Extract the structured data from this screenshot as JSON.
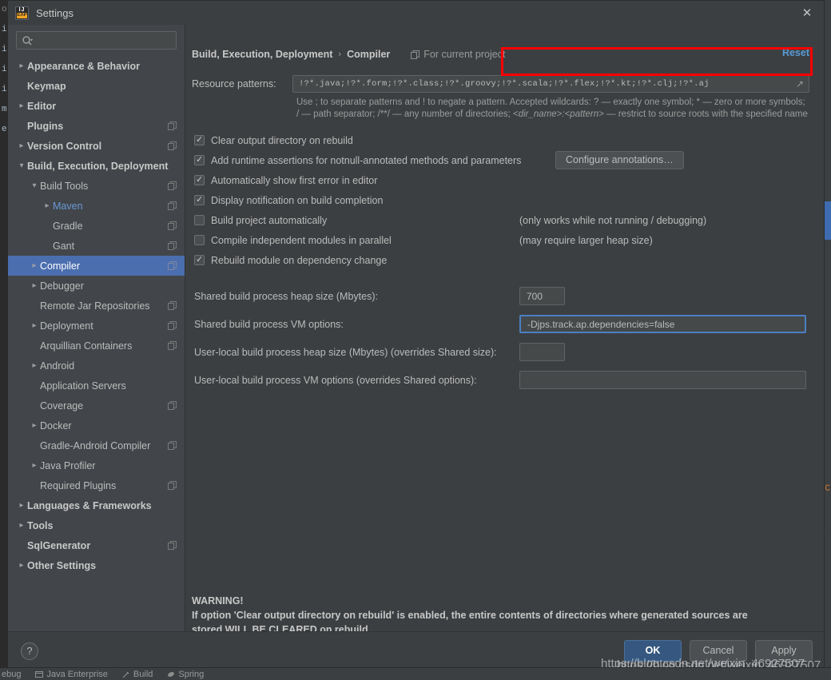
{
  "window": {
    "title": "Settings",
    "app_icon": "intellij-idea-eap-icon",
    "icon_top_text": "IJ",
    "icon_bottom_text": "EAP",
    "close_label": "✕"
  },
  "sidebar": {
    "search": {
      "placeholder": "",
      "value": "",
      "icon": "search-icon"
    },
    "items": [
      {
        "label": "Appearance & Behavior",
        "indent": 0,
        "arrow": "closed",
        "bold": true,
        "project": false,
        "selected": false,
        "blue": false
      },
      {
        "label": "Keymap",
        "indent": 0,
        "arrow": "none",
        "bold": true,
        "project": false,
        "selected": false,
        "blue": false
      },
      {
        "label": "Editor",
        "indent": 0,
        "arrow": "closed",
        "bold": true,
        "project": false,
        "selected": false,
        "blue": false
      },
      {
        "label": "Plugins",
        "indent": 0,
        "arrow": "none",
        "bold": true,
        "project": true,
        "selected": false,
        "blue": false
      },
      {
        "label": "Version Control",
        "indent": 0,
        "arrow": "closed",
        "bold": true,
        "project": true,
        "selected": false,
        "blue": false
      },
      {
        "label": "Build, Execution, Deployment",
        "indent": 0,
        "arrow": "open",
        "bold": true,
        "project": false,
        "selected": false,
        "blue": false
      },
      {
        "label": "Build Tools",
        "indent": 1,
        "arrow": "open",
        "bold": false,
        "project": true,
        "selected": false,
        "blue": false
      },
      {
        "label": "Maven",
        "indent": 2,
        "arrow": "closed",
        "bold": false,
        "project": true,
        "selected": false,
        "blue": true
      },
      {
        "label": "Gradle",
        "indent": 2,
        "arrow": "none",
        "bold": false,
        "project": true,
        "selected": false,
        "blue": false
      },
      {
        "label": "Gant",
        "indent": 2,
        "arrow": "none",
        "bold": false,
        "project": true,
        "selected": false,
        "blue": false
      },
      {
        "label": "Compiler",
        "indent": 1,
        "arrow": "closed",
        "bold": false,
        "project": true,
        "selected": true,
        "blue": false
      },
      {
        "label": "Debugger",
        "indent": 1,
        "arrow": "closed",
        "bold": false,
        "project": false,
        "selected": false,
        "blue": false
      },
      {
        "label": "Remote Jar Repositories",
        "indent": 1,
        "arrow": "none",
        "bold": false,
        "project": true,
        "selected": false,
        "blue": false
      },
      {
        "label": "Deployment",
        "indent": 1,
        "arrow": "closed",
        "bold": false,
        "project": true,
        "selected": false,
        "blue": false
      },
      {
        "label": "Arquillian Containers",
        "indent": 1,
        "arrow": "none",
        "bold": false,
        "project": true,
        "selected": false,
        "blue": false
      },
      {
        "label": "Android",
        "indent": 1,
        "arrow": "closed",
        "bold": false,
        "project": false,
        "selected": false,
        "blue": false
      },
      {
        "label": "Application Servers",
        "indent": 1,
        "arrow": "none",
        "bold": false,
        "project": false,
        "selected": false,
        "blue": false
      },
      {
        "label": "Coverage",
        "indent": 1,
        "arrow": "none",
        "bold": false,
        "project": true,
        "selected": false,
        "blue": false
      },
      {
        "label": "Docker",
        "indent": 1,
        "arrow": "closed",
        "bold": false,
        "project": false,
        "selected": false,
        "blue": false
      },
      {
        "label": "Gradle-Android Compiler",
        "indent": 1,
        "arrow": "none",
        "bold": false,
        "project": true,
        "selected": false,
        "blue": false
      },
      {
        "label": "Java Profiler",
        "indent": 1,
        "arrow": "closed",
        "bold": false,
        "project": false,
        "selected": false,
        "blue": false
      },
      {
        "label": "Required Plugins",
        "indent": 1,
        "arrow": "none",
        "bold": false,
        "project": true,
        "selected": false,
        "blue": false
      },
      {
        "label": "Languages & Frameworks",
        "indent": 0,
        "arrow": "closed",
        "bold": true,
        "project": false,
        "selected": false,
        "blue": false
      },
      {
        "label": "Tools",
        "indent": 0,
        "arrow": "closed",
        "bold": true,
        "project": false,
        "selected": false,
        "blue": false
      },
      {
        "label": "SqlGenerator",
        "indent": 0,
        "arrow": "none",
        "bold": true,
        "project": true,
        "selected": false,
        "blue": false
      },
      {
        "label": "Other Settings",
        "indent": 0,
        "arrow": "closed",
        "bold": true,
        "project": false,
        "selected": false,
        "blue": false
      }
    ]
  },
  "main": {
    "breadcrumb": {
      "parent": "Build, Execution, Deployment",
      "separator": "›",
      "current": "Compiler"
    },
    "scope_badge": {
      "icon": "project-scope-icon",
      "text": "For current project"
    },
    "reset_label": "Reset",
    "resource_patterns": {
      "label": "Resource patterns:",
      "value": "!?*.java;!?*.form;!?*.class;!?*.groovy;!?*.scala;!?*.flex;!?*.kt;!?*.clj;!?*.aj",
      "placeholder": "",
      "expand_icon": "expand-field-icon",
      "hint_line1": "Use ; to separate patterns and ! to negate a pattern. Accepted wildcards: ? — exactly one symbol; * — zero or more",
      "hint_line2_a": "symbols; / — path separator; /**/ — any number of directories; ",
      "hint_line2_i": "<dir_name>:<pattern>",
      "hint_line2_b": " — restrict to source roots with the",
      "hint_line3": "specified name"
    },
    "checkboxes": [
      {
        "label": "Clear output directory on rebuild",
        "checked": true,
        "note": ""
      },
      {
        "label": "Add runtime assertions for notnull-annotated methods and parameters",
        "checked": true,
        "note": ""
      },
      {
        "label": "Automatically show first error in editor",
        "checked": true,
        "note": ""
      },
      {
        "label": "Display notification on build completion",
        "checked": true,
        "note": ""
      },
      {
        "label": "Build project automatically",
        "checked": false,
        "note": "(only works while not running / debugging)"
      },
      {
        "label": "Compile independent modules in parallel",
        "checked": false,
        "note": "(may require larger heap size)"
      },
      {
        "label": "Rebuild module on dependency change",
        "checked": true,
        "note": ""
      }
    ],
    "configure_annotations_label": "Configure annotations…",
    "options": [
      {
        "label": "Shared build process heap size (Mbytes):",
        "value": "700",
        "size": "small",
        "focused": false
      },
      {
        "label": "Shared build process VM options:",
        "value": "-Djps.track.ap.dependencies=false",
        "size": "wide",
        "focused": true
      },
      {
        "label": "User-local build process heap size (Mbytes) (overrides Shared size):",
        "value": "",
        "size": "small",
        "focused": false
      },
      {
        "label": "User-local build process VM options (overrides Shared options):",
        "value": "",
        "size": "wide",
        "focused": false
      }
    ],
    "warning": {
      "title": "WARNING!",
      "line1": "If option 'Clear output directory on rebuild' is enabled, the entire contents of directories where generated sources are",
      "line2": "stored WILL BE CLEARED on rebuild."
    }
  },
  "footer": {
    "help_label": "?",
    "ok_label": "OK",
    "cancel_label": "Cancel",
    "apply_label": "Apply"
  },
  "ide_background": {
    "left_gutter_chars": "o\ni\ni\ni\ni\nm\ne",
    "right_chars": "<C\n\nA",
    "bottom_tools": [
      {
        "label": "ebug",
        "icon": "debug-icon"
      },
      {
        "label": "Java Enterprise",
        "icon": "java-enterprise-icon"
      },
      {
        "label": "Build",
        "icon": "build-icon"
      },
      {
        "label": "Spring",
        "icon": "spring-icon"
      }
    ]
  },
  "watermark": {
    "text_a": "https://blog.csdn.net/weixin_46927507",
    "text_b": "https://blog.csdn.net/weixin_46927507"
  },
  "colors": {
    "accent_blue": "#4b6eaf",
    "link_blue": "#5a9bd5",
    "maven_blue": "#6897d4",
    "highlight_red": "#ff0000",
    "dialog_bg": "#3c3f41",
    "sidebar_bg": "#42464a",
    "field_bg": "#45494a",
    "primary_button": "#365880"
  }
}
